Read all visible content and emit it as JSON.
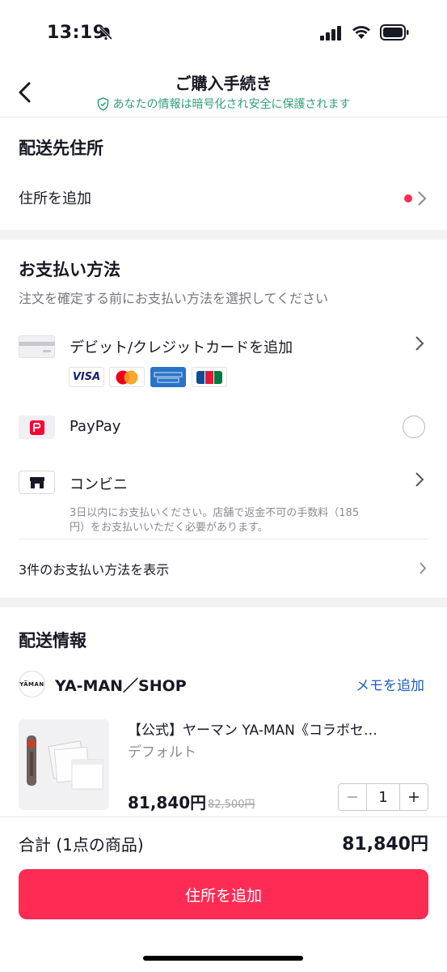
{
  "status_bar": {
    "time": "13:19"
  },
  "header": {
    "title": "ご購入手続き",
    "subtitle": "あなたの情報は暗号化され安全に保護されます"
  },
  "shipping_address": {
    "title": "配送先住所",
    "add_label": "住所を追加"
  },
  "payment": {
    "title": "お支払い方法",
    "subtitle": "注文を確定する前にお支払い方法を選択してください",
    "card": {
      "label": "デビット/クレジットカードを追加",
      "brands": [
        "VISA",
        "Mastercard",
        "AMERICAN EXPRESS",
        "JCB"
      ]
    },
    "paypay": {
      "label": "PayPay"
    },
    "konbini": {
      "label": "コンビニ",
      "note_line1": "3日以内にお支払いください。店舗で返金不可の手数料（185",
      "note_line2": "円）をお支払いいただく必要があります。"
    },
    "more_label": "3件のお支払い方法を表示"
  },
  "delivery": {
    "title": "配送情報",
    "shop_name": "YA-MAN／SHOP",
    "shop_logo": "YA̅MAN",
    "memo_label": "メモを追加",
    "product": {
      "title": "【公式】ヤーマン YA-MAN《コラボセ…",
      "variant": "デフォルト",
      "price": "81,840円",
      "original_price": "82,500円",
      "quantity": "1"
    }
  },
  "footer": {
    "total_label": "合計 (1点の商品)",
    "total_value": "81,840円",
    "button_label": "住所を追加"
  },
  "colors": {
    "accent": "#fe2c55",
    "secure_green": "#2e9f7a",
    "link_blue": "#1f5fbf"
  }
}
